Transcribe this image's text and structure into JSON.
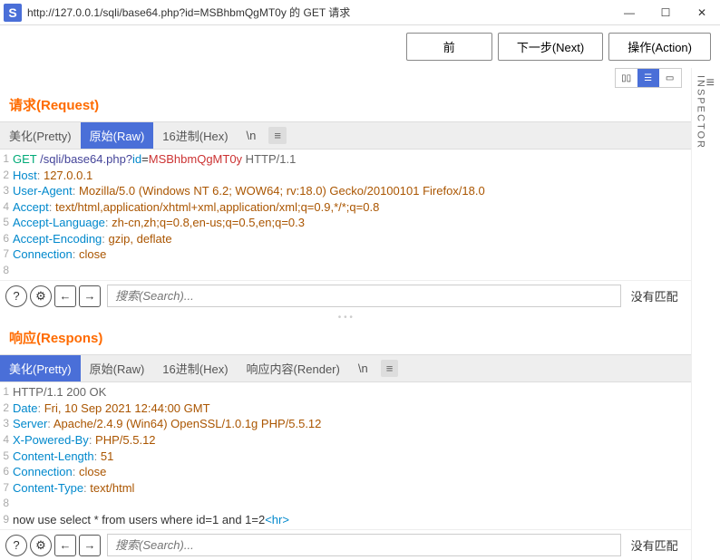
{
  "window": {
    "title": "http://127.0.0.1/sqli/base64.php?id=MSBhbmQgMT0y 的 GET 请求"
  },
  "toolbar": {
    "back": "前",
    "next": "下一步(Next)",
    "action": "操作(Action)"
  },
  "sidebar": {
    "inspector": "INSPECTOR"
  },
  "request": {
    "title": "请求(Request)",
    "tabs": {
      "pretty": "美化(Pretty)",
      "raw": "原始(Raw)",
      "hex": "16进制(Hex)",
      "newline": "\\n"
    },
    "lines": [
      {
        "n": "1",
        "method": "GET",
        "path": " /sqli/base64.php?",
        "param": "id",
        "val": "MSBhbmQgMT0y",
        "proto": " HTTP/1.1"
      },
      {
        "n": "2",
        "h": "Host",
        "v": " 127.0.0.1"
      },
      {
        "n": "3",
        "h": "User-Agent",
        "v": " Mozilla/5.0 (Windows NT 6.2; WOW64; rv:18.0) Gecko/20100101 Firefox/18.0"
      },
      {
        "n": "4",
        "h": "Accept",
        "v": " text/html,application/xhtml+xml,application/xml;q=0.9,*/*;q=0.8"
      },
      {
        "n": "5",
        "h": "Accept-Language",
        "v": " zh-cn,zh;q=0.8,en-us;q=0.5,en;q=0.3"
      },
      {
        "n": "6",
        "h": "Accept-Encoding",
        "v": " gzip, deflate"
      },
      {
        "n": "7",
        "h": "Connection",
        "v": " close"
      },
      {
        "n": "8"
      }
    ],
    "search_placeholder": "搜索(Search)...",
    "nomatch": "没有匹配"
  },
  "response": {
    "title": "响应(Respons)",
    "tabs": {
      "pretty": "美化(Pretty)",
      "raw": "原始(Raw)",
      "hex": "16进制(Hex)",
      "render": "响应内容(Render)",
      "newline": "\\n"
    },
    "lines": [
      {
        "n": "1",
        "status": "HTTP/1.1 200 OK"
      },
      {
        "n": "2",
        "h": "Date",
        "v": " Fri, 10 Sep 2021 12:44:00 GMT"
      },
      {
        "n": "3",
        "h": "Server",
        "v": " Apache/2.4.9 (Win64) OpenSSL/1.0.1g PHP/5.5.12"
      },
      {
        "n": "4",
        "h": "X-Powered-By",
        "v": " PHP/5.5.12"
      },
      {
        "n": "5",
        "h": "Content-Length",
        "v": " 51"
      },
      {
        "n": "6",
        "h": "Connection",
        "v": " close"
      },
      {
        "n": "7",
        "h": "Content-Type",
        "v": " text/html"
      },
      {
        "n": "8"
      },
      {
        "n": "9",
        "body_pre": "now use select * from users where id=1 and 1=2",
        "body_tag": "<hr>"
      }
    ],
    "search_placeholder": "搜索(Search)...",
    "nomatch": "没有匹配"
  }
}
